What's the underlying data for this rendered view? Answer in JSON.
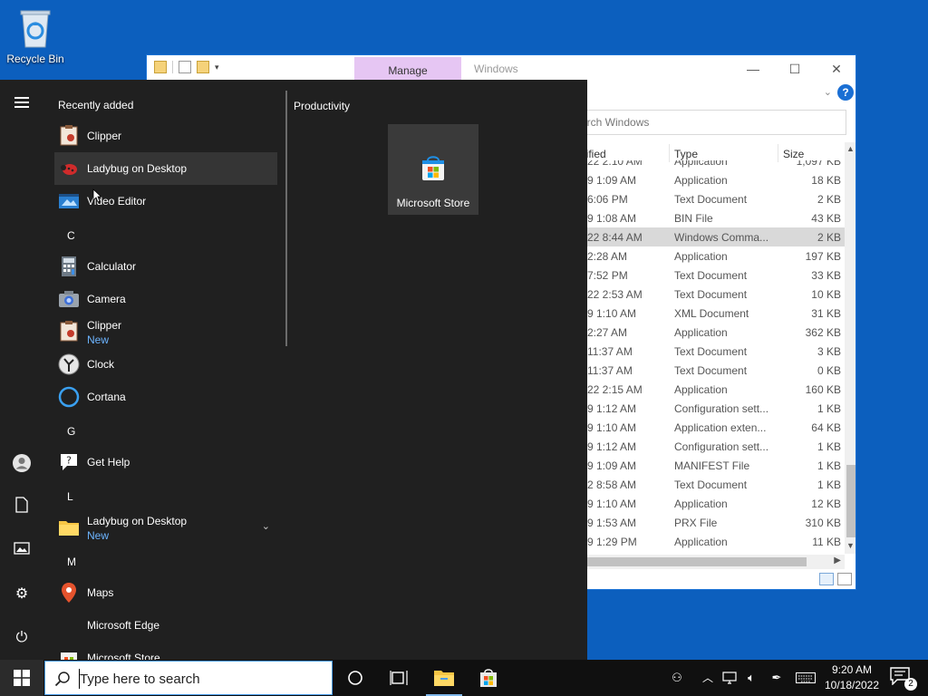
{
  "desktop": {
    "recycle_bin_label": "Recycle Bin"
  },
  "explorer": {
    "manage_tab": "Manage",
    "title": "Windows",
    "search_placeholder": "arch Windows",
    "columns": {
      "modified": "dified",
      "type": "Type",
      "size": "Size"
    },
    "rows": [
      {
        "modified": "22 2:10 AM",
        "type": "Application",
        "size": "1,097 KB"
      },
      {
        "modified": "9 1:09 AM",
        "type": "Application",
        "size": "18 KB"
      },
      {
        "modified": "6:06 PM",
        "type": "Text Document",
        "size": "2 KB"
      },
      {
        "modified": "9 1:08 AM",
        "type": "BIN File",
        "size": "43 KB"
      },
      {
        "modified": "22 8:44 AM",
        "type": "Windows Comma...",
        "size": "2 KB"
      },
      {
        "modified": "2:28 AM",
        "type": "Application",
        "size": "197 KB"
      },
      {
        "modified": "7:52 PM",
        "type": "Text Document",
        "size": "33 KB"
      },
      {
        "modified": "22 2:53 AM",
        "type": "Text Document",
        "size": "10 KB"
      },
      {
        "modified": "9 1:10 AM",
        "type": "XML Document",
        "size": "31 KB"
      },
      {
        "modified": "2:27 AM",
        "type": "Application",
        "size": "362 KB"
      },
      {
        "modified": "11:37 AM",
        "type": "Text Document",
        "size": "3 KB"
      },
      {
        "modified": "11:37 AM",
        "type": "Text Document",
        "size": "0 KB"
      },
      {
        "modified": "22 2:15 AM",
        "type": "Application",
        "size": "160 KB"
      },
      {
        "modified": "9 1:12 AM",
        "type": "Configuration sett...",
        "size": "1 KB"
      },
      {
        "modified": "9 1:10 AM",
        "type": "Application exten...",
        "size": "64 KB"
      },
      {
        "modified": "9 1:12 AM",
        "type": "Configuration sett...",
        "size": "1 KB"
      },
      {
        "modified": "9 1:09 AM",
        "type": "MANIFEST File",
        "size": "1 KB"
      },
      {
        "modified": "2 8:58 AM",
        "type": "Text Document",
        "size": "1 KB"
      },
      {
        "modified": "9 1:10 AM",
        "type": "Application",
        "size": "12 KB"
      },
      {
        "modified": "9 1:53 AM",
        "type": "PRX File",
        "size": "310 KB"
      },
      {
        "modified": "9 1:29 PM",
        "type": "Application",
        "size": "11 KB"
      }
    ]
  },
  "start_menu": {
    "recently_added": "Recently added",
    "productivity": "Productivity",
    "apps": {
      "clipper_recent": "Clipper",
      "ladybug_recent": "Ladybug on Desktop",
      "video_editor": "Video Editor",
      "letter_c": "C",
      "calculator": "Calculator",
      "camera": "Camera",
      "clipper": "Clipper",
      "clipper_sub": "New",
      "clock": "Clock",
      "cortana": "Cortana",
      "letter_g": "G",
      "get_help": "Get Help",
      "letter_l": "L",
      "ladybug_folder": "Ladybug on Desktop",
      "ladybug_folder_sub": "New",
      "letter_m": "M",
      "maps": "Maps",
      "edge": "Microsoft Edge",
      "store": "Microsoft Store"
    },
    "tile_store": "Microsoft Store"
  },
  "taskbar": {
    "search_placeholder": "Type here to search",
    "time": "9:20 AM",
    "date": "10/18/2022",
    "notification_count": "2"
  },
  "colors": {
    "desktop": "#0c5fbe",
    "start_bg": "#202020",
    "accent_link": "#6cb4ff",
    "manage_tab": "#e6c6f3"
  }
}
